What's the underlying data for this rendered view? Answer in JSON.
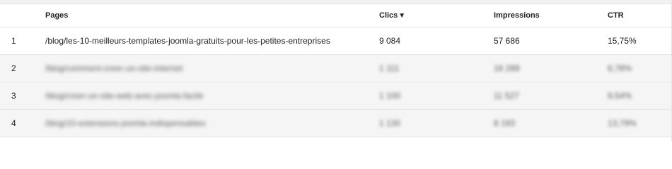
{
  "columns": {
    "pages": "Pages",
    "clicks": "Clics",
    "clicks_sort_indicator": "▼",
    "impressions": "Impressions",
    "ctr": "CTR"
  },
  "rows": [
    {
      "index": "1",
      "page": "/blog/les-10-meilleurs-templates-joomla-gratuits-pour-les-petites-entreprises",
      "clicks": "9 084",
      "impressions": "57 686",
      "ctr": "15,75%",
      "blurred": false
    },
    {
      "index": "2",
      "page": "/blog/comment-creer-un-site-internet",
      "clicks": "1 111",
      "impressions": "16 289",
      "ctr": "6,78%",
      "blurred": true
    },
    {
      "index": "3",
      "page": "/blog/creer-un-site-web-avec-joomla-facile",
      "clicks": "1 100",
      "impressions": "11 527",
      "ctr": "9,54%",
      "blurred": true
    },
    {
      "index": "4",
      "page": "/blog/10-extensions-joomla-indispensables",
      "clicks": "1 130",
      "impressions": "8 193",
      "ctr": "13,79%",
      "blurred": true
    }
  ]
}
